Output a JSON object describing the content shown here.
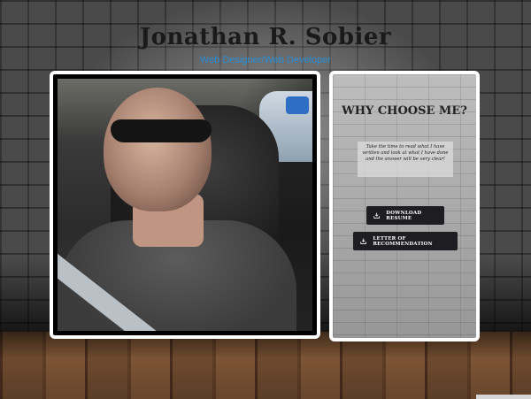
{
  "header": {
    "name": "Jonathan R. Sobier",
    "tagline": "Web Designer/Web Developer"
  },
  "photo": {
    "alt": "profile-photo"
  },
  "why": {
    "title": "WHY CHOOSE ME?",
    "quote": "Take the time to read what I have written and look at what I have done and the answer will be very clear!"
  },
  "buttons": {
    "resume": {
      "label": "DOWNLOAD RESUME",
      "icon": "download-icon"
    },
    "letter": {
      "label": "LETTER OF RECOMMENDATION",
      "icon": "download-icon"
    }
  },
  "colors": {
    "tagline": "#2a8fd6",
    "button_bg": "#1d1d22",
    "frame": "#ffffff"
  }
}
